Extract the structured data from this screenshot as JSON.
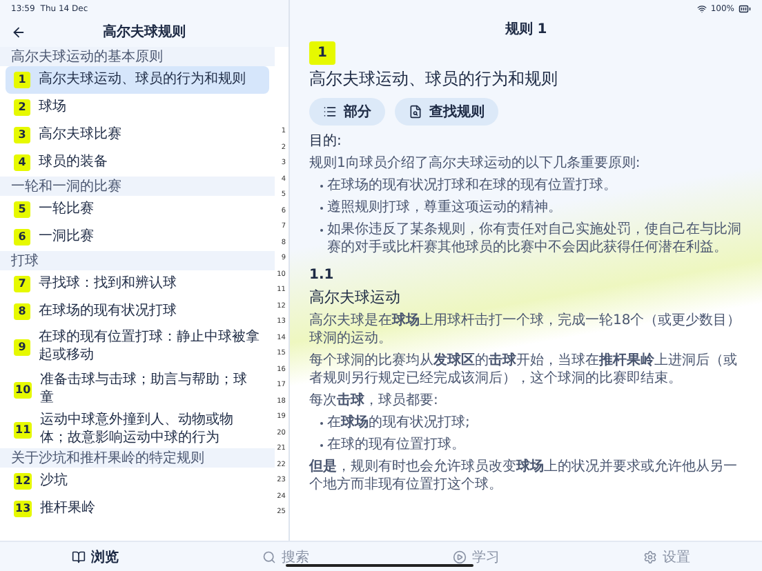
{
  "status_bar": {
    "time": "13:59",
    "date": "Thu 14 Dec",
    "battery": "100%"
  },
  "sidebar": {
    "title": "高尔夫球规则",
    "sections": [
      {
        "heading": "高尔夫球运动的基本原则",
        "items": [
          {
            "number": "1",
            "label": "高尔夫球运动、球员的行为和规则",
            "selected": true
          },
          {
            "number": "2",
            "label": "球场",
            "selected": false
          },
          {
            "number": "3",
            "label": "高尔夫球比赛",
            "selected": false
          },
          {
            "number": "4",
            "label": "球员的装备",
            "selected": false
          }
        ]
      },
      {
        "heading": "一轮和一洞的比赛",
        "items": [
          {
            "number": "5",
            "label": "一轮比赛",
            "selected": false
          },
          {
            "number": "6",
            "label": "一洞比赛",
            "selected": false
          }
        ]
      },
      {
        "heading": "打球",
        "items": [
          {
            "number": "7",
            "label": "寻找球：找到和辨认球",
            "selected": false
          },
          {
            "number": "8",
            "label": "在球场的现有状况打球",
            "selected": false
          },
          {
            "number": "9",
            "label": "在球的现有位置打球：静止中球被拿起或移动",
            "selected": false
          },
          {
            "number": "10",
            "label": "准备击球与击球；助言与帮助；球童",
            "selected": false
          },
          {
            "number": "11",
            "label": "运动中球意外撞到人、动物或物体；故意影响运动中球的行为",
            "selected": false
          }
        ]
      },
      {
        "heading": "关于沙坑和推杆果岭的特定规则",
        "items": [
          {
            "number": "12",
            "label": "沙坑",
            "selected": false
          },
          {
            "number": "13",
            "label": "推杆果岭",
            "selected": false
          }
        ]
      }
    ],
    "index": [
      "1",
      "2",
      "3",
      "4",
      "5",
      "6",
      "7",
      "8",
      "9",
      "10",
      "11",
      "12",
      "13",
      "14",
      "15",
      "16",
      "17",
      "18",
      "19",
      "20",
      "21",
      "22",
      "23",
      "24",
      "25"
    ]
  },
  "detail": {
    "title": "规则 1",
    "badge": "1",
    "heading": "高尔夫球运动、球员的行为和规则",
    "buttons": [
      {
        "kind": "sections",
        "label": "部分"
      },
      {
        "kind": "find",
        "label": "查找规则"
      }
    ],
    "purpose_label": "目的:",
    "purpose_intro": "规则1向球员介绍了高尔夫球运动的以下几条重要原则:",
    "purpose_points": [
      "在球场的现有状况打球和在球的现有位置打球。",
      "遵照规则打球，尊重这项运动的精神。",
      "如果你违反了某条规则，你有责任对自己实施处罚，使自己在与比洞赛的对手或比杆赛其他球员的比赛中不会因此获得任何潜在利益。"
    ],
    "section_number": "1.1",
    "section_title": "高尔夫球运动",
    "paragraphs": [
      "高尔夫球是在**球场**上用球杆击打一个球，完成一轮18个（或更少数目）球洞的运动。",
      "每个球洞的比赛均从**发球区**的**击球**开始，当球在**推杆果岭**上进洞后（或者规则另行规定已经完成该洞后），这个球洞的比赛即结束。",
      "每次**击球**，球员都要:"
    ],
    "points": [
      "在**球场**的现有状况打球;",
      "在球的现有位置打球。"
    ],
    "closing": "**但是**，规则有时也会允许球员改变**球场**上的状况并要求或允许他从另一个地方而非现有位置打这个球。"
  },
  "tab_bar": [
    {
      "kind": "browse",
      "label": "浏览",
      "selected": true
    },
    {
      "kind": "search",
      "label": "搜索",
      "selected": false
    },
    {
      "kind": "learn",
      "label": "学习",
      "selected": false
    },
    {
      "kind": "settings",
      "label": "设置",
      "selected": false
    }
  ]
}
